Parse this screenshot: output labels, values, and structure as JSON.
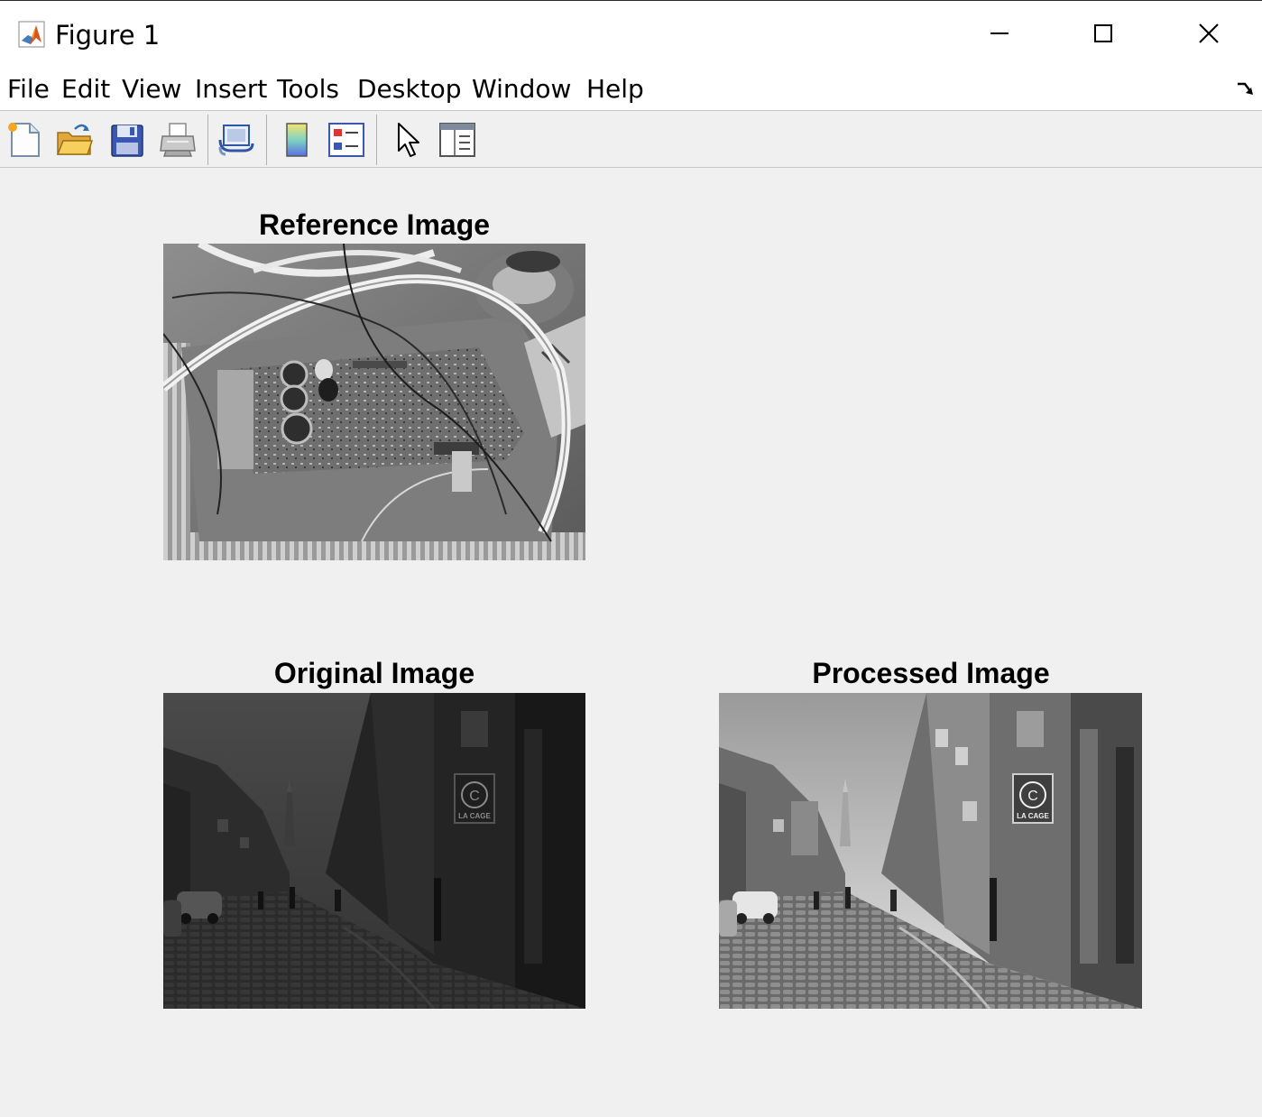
{
  "window": {
    "title": "Figure 1",
    "icon": "matlab-logo-icon",
    "controls": [
      "minimize-icon",
      "maximize-icon",
      "close-icon"
    ]
  },
  "menubar": {
    "items": [
      "File",
      "Edit",
      "View",
      "Insert",
      "Tools",
      "Desktop",
      "Window",
      "Help"
    ],
    "dock_icon": "dock-arrow-icon"
  },
  "toolbar": {
    "tools": [
      "new-figure-icon",
      "open-file-icon",
      "save-icon",
      "print-icon",
      "link-plot-icon",
      "colorbar-icon",
      "legend-icon",
      "pointer-icon",
      "property-inspector-icon"
    ]
  },
  "axes": {
    "reference": {
      "title": "Reference Image"
    },
    "original": {
      "title": "Original Image"
    },
    "processed": {
      "title": "Processed Image"
    }
  },
  "photo_text": {
    "sign_letter": "C",
    "sign_text": "LA CAGE"
  }
}
